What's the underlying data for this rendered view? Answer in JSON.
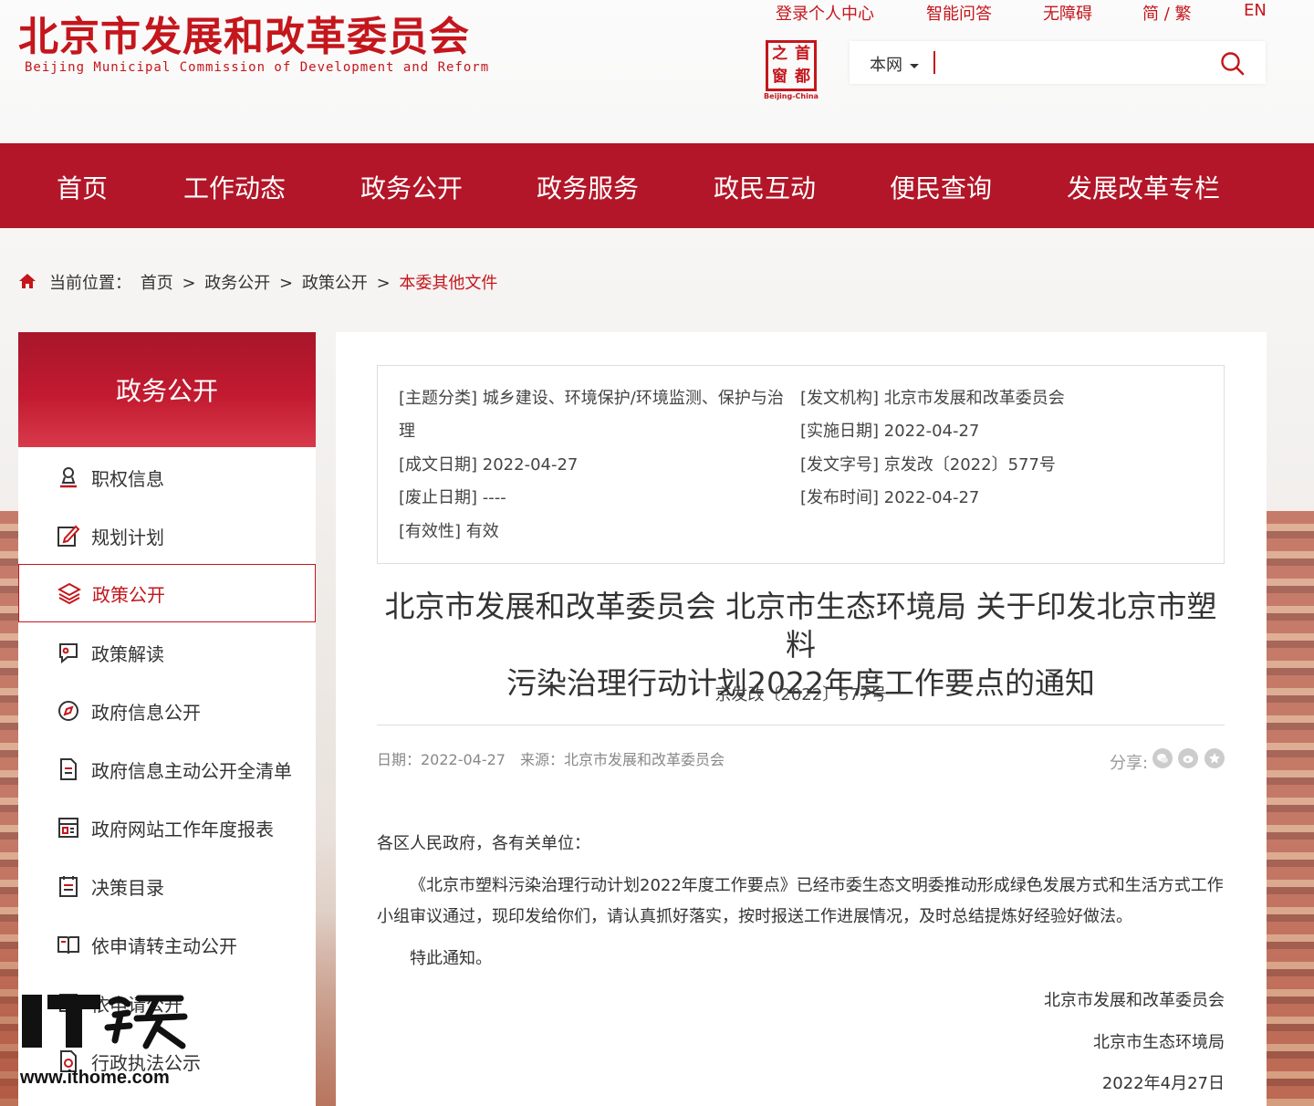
{
  "header": {
    "logo_cn": "北京市发展和改革委员会",
    "logo_en": "Beijing Municipal Commission of Development and Reform",
    "top_links": [
      "登录个人中心",
      "智能问答",
      "无障碍",
      "简 / 繁",
      "EN"
    ],
    "seal_chars": [
      "之",
      "首",
      "窗",
      "都"
    ],
    "seal_caption": "Beijing-China",
    "search": {
      "scope": "本网",
      "placeholder": ""
    }
  },
  "nav": {
    "items": [
      "首页",
      "工作动态",
      "政务公开",
      "政务服务",
      "政民互动",
      "便民查询",
      "发展改革专栏"
    ]
  },
  "breadcrumb": {
    "label": "当前位置：",
    "items": [
      "首页",
      "政务公开",
      "政策公开"
    ],
    "separator": ">",
    "current": "本委其他文件"
  },
  "sidebar": {
    "title": "政务公开",
    "items": [
      {
        "label": "职权信息",
        "icon": "user-stamp-icon"
      },
      {
        "label": "规划计划",
        "icon": "edit-document-icon"
      },
      {
        "label": "政策公开",
        "icon": "layers-icon",
        "active": true
      },
      {
        "label": "政策解读",
        "icon": "chat-icon"
      },
      {
        "label": "政府信息公开",
        "icon": "compass-icon"
      },
      {
        "label": "政府信息主动公开全清单",
        "icon": "document-icon"
      },
      {
        "label": "政府网站工作年度报表",
        "icon": "report-icon"
      },
      {
        "label": "决策目录",
        "icon": "calendar-list-icon"
      },
      {
        "label": "依申请转主动公开",
        "icon": "book-icon"
      },
      {
        "label": "依申请公开",
        "icon": "list-icon"
      },
      {
        "label": "行政执法公示",
        "icon": "law-icon"
      }
    ]
  },
  "meta": {
    "topic": "[主题分类] 城乡建设、环境保护/环境监测、保护与治",
    "topic_cont": "理",
    "issuer": "[发文机构] 北京市发展和改革委员会",
    "effective_date": "[实施日期] 2022-04-27",
    "written_date": "[成文日期] 2022-04-27",
    "doc_no": "[发文字号] 京发改〔2022〕577号",
    "abolish_date": "[废止日期] ----",
    "publish_time": "[发布时间] 2022-04-27",
    "validity": "[有效性] 有效"
  },
  "document": {
    "title_line1": "北京市发展和改革委员会 北京市生态环境局 关于印发北京市塑料",
    "title_line2": "污染治理行动计划2022年度工作要点的通知",
    "number": "京发改〔2022〕577号",
    "info": "日期：2022-04-27　来源：北京市发展和改革委员会",
    "share_label": "分享:",
    "share_icons": [
      "wechat-icon",
      "weibo-icon",
      "favorite-icon"
    ],
    "salutation": "各区人民政府，各有关单位：",
    "paragraph": "《北京市塑料污染治理行动计划2022年度工作要点》已经市委生态文明委推动形成绿色发展方式和生活方式工作小组审议通过，现印发给你们，请认真抓好落实，按时报送工作进展情况，及时总结提炼好经验好做法。",
    "closing": "特此通知。",
    "signers": [
      "北京市发展和改革委员会",
      "北京市生态环境局"
    ],
    "sign_date": "2022年4月27日"
  },
  "watermark": {
    "logo": "IT之家",
    "url": "www.ithome.com"
  },
  "colors": {
    "brand_red": "#c4161c",
    "nav_red": "#b21628"
  }
}
